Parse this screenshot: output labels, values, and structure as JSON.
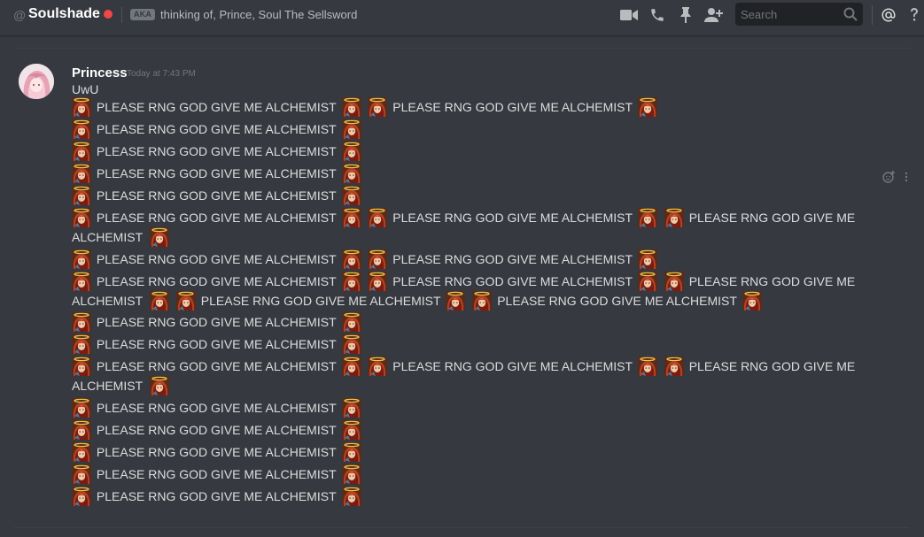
{
  "header": {
    "at_symbol": "@",
    "channel_name": "Soulshade",
    "aka_badge": "AKA",
    "aka_text": "thinking of, Prince, Soul The Sellsword",
    "search_placeholder": "Search",
    "icons": [
      "video-call-icon",
      "phone-call-icon",
      "pin-icon",
      "add-friend-icon",
      "search-icon",
      "mention-icon",
      "help-icon"
    ]
  },
  "message": {
    "author": "Princess",
    "timestamp": "Today at 7:43 PM",
    "first_line": "UwU",
    "phrase": "PLEASE RNG GOD GIVE ME ALCHEMIST",
    "wrap_part1": "PLEASE RNG GOD GIVE",
    "wrap_part2": "ME",
    "wrap_tail": "ALCHEMIST"
  },
  "colors": {
    "background": "#36393f",
    "status_dnd": "#f04747",
    "text": "#dcddde",
    "muted": "#72767d"
  }
}
